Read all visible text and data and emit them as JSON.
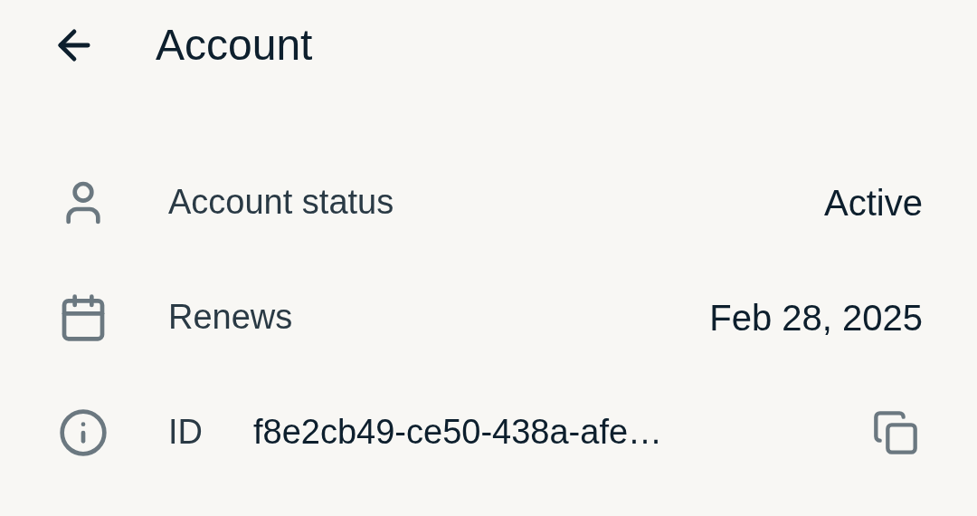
{
  "header": {
    "title": "Account"
  },
  "rows": [
    {
      "kind": "text",
      "label": "Account status",
      "value": "Active"
    },
    {
      "kind": "text",
      "label": "Renews",
      "value": "Feb 28, 2025"
    },
    {
      "kind": "copyable",
      "label": "ID",
      "value": "f8e2cb49-ce50-438a-afe…"
    }
  ]
}
